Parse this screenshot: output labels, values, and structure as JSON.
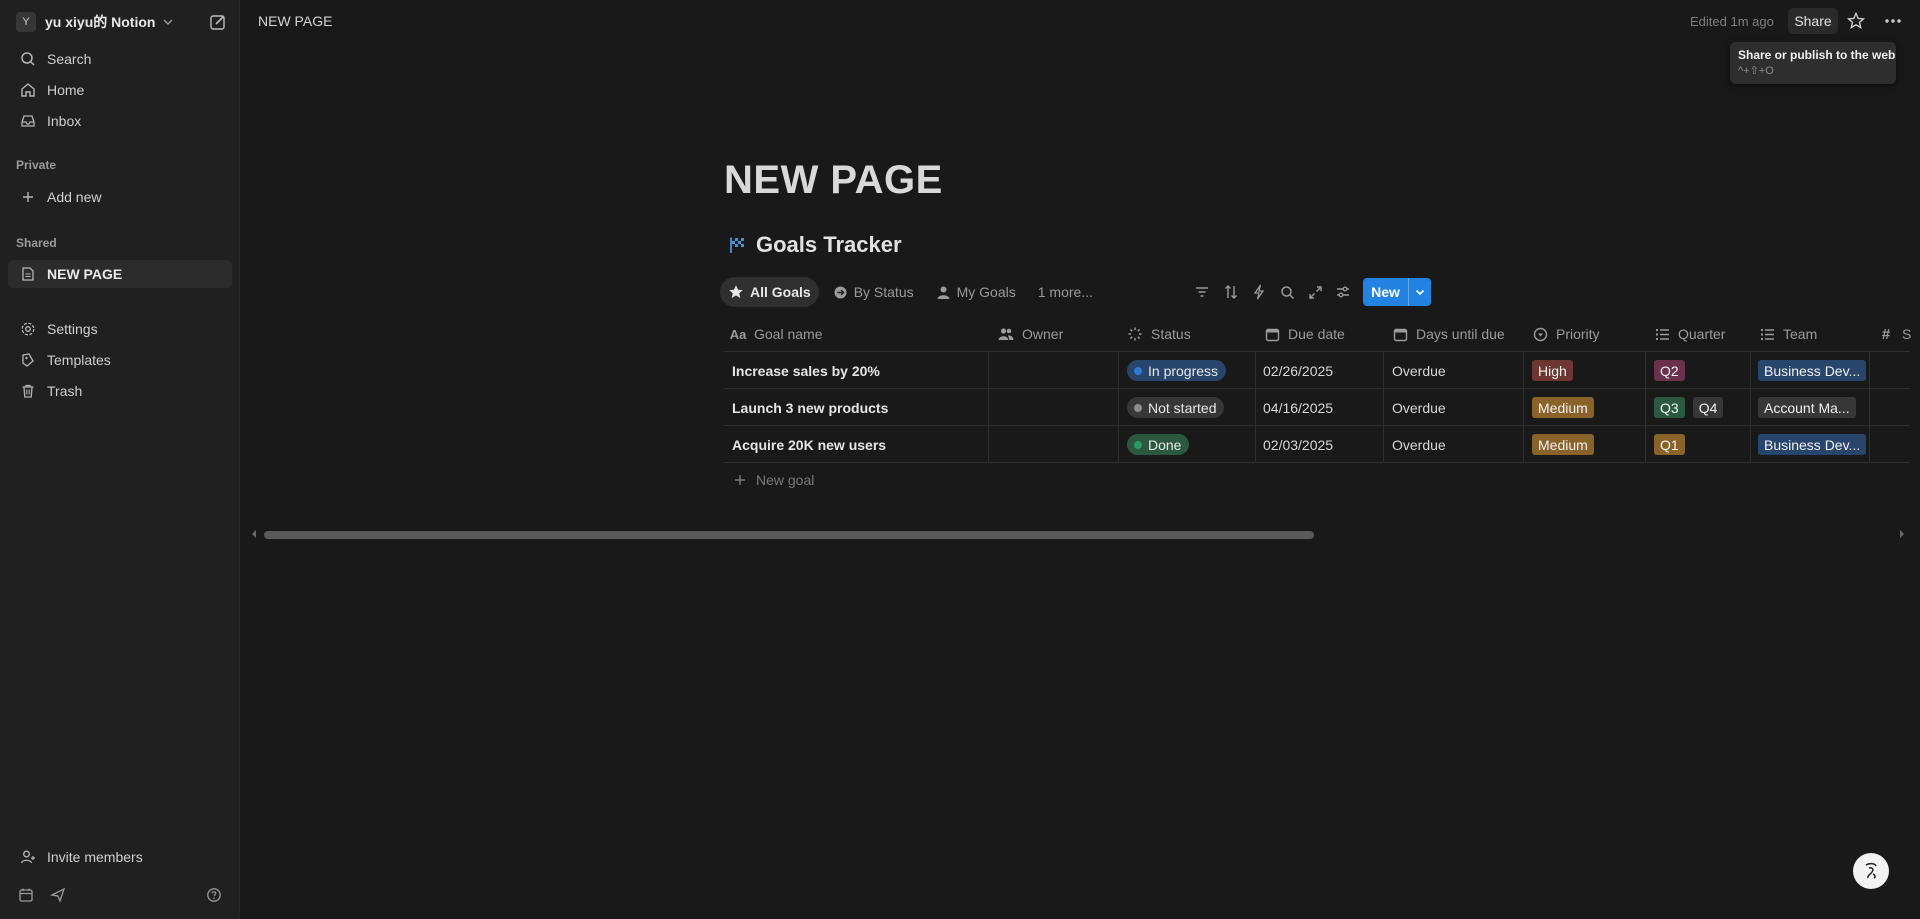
{
  "sidebar": {
    "workspace": {
      "avatar": "Y",
      "name": "yu xiyu的 Notion"
    },
    "nav": [
      {
        "label": "Search",
        "icon": "search-icon"
      },
      {
        "label": "Home",
        "icon": "home-icon"
      },
      {
        "label": "Inbox",
        "icon": "inbox-icon"
      }
    ],
    "private_label": "Private",
    "add_new": "Add new",
    "shared_label": "Shared",
    "shared_page": "NEW PAGE",
    "settings": "Settings",
    "templates": "Templates",
    "trash": "Trash",
    "invite": "Invite members"
  },
  "topbar": {
    "breadcrumb": "NEW PAGE",
    "edited": "Edited 1m ago",
    "share": "Share",
    "tooltip_title": "Share or publish to the web",
    "tooltip_shortcut": "^+⇧+O"
  },
  "page": {
    "title": "NEW PAGE",
    "database_title": "Goals Tracker"
  },
  "views": {
    "tabs": [
      {
        "label": "All Goals",
        "icon": "star-icon",
        "active": true
      },
      {
        "label": "By Status",
        "icon": "status-icon",
        "active": false
      },
      {
        "label": "My Goals",
        "icon": "person-icon",
        "active": false
      }
    ],
    "more": "1 more...",
    "new_button": "New"
  },
  "table": {
    "columns": {
      "goal_name": "Goal name",
      "owner": "Owner",
      "status": "Status",
      "due_date": "Due date",
      "days_until_due": "Days until due",
      "priority": "Priority",
      "quarter": "Quarter",
      "team": "Team",
      "extra": "S"
    },
    "rows": [
      {
        "name": "Increase sales by 20%",
        "owner": "",
        "status": "In progress",
        "due": "02/26/2025",
        "days": "Overdue",
        "priority": "High",
        "quarter": [
          "Q2"
        ],
        "team": "Business Dev..."
      },
      {
        "name": "Launch 3 new products",
        "owner": "",
        "status": "Not started",
        "due": "04/16/2025",
        "days": "Overdue",
        "priority": "Medium",
        "quarter": [
          "Q3",
          "Q4"
        ],
        "team": "Account Ma..."
      },
      {
        "name": "Acquire 20K new users",
        "owner": "",
        "status": "Done",
        "due": "02/03/2025",
        "days": "Overdue",
        "priority": "Medium",
        "quarter": [
          "Q1"
        ],
        "team": "Business Dev..."
      }
    ],
    "new_row": "New goal"
  },
  "colors": {
    "accent": "#2383e2",
    "status_in_progress_bg": "#28456c",
    "status_in_progress_dot": "#2e7cd1",
    "status_not_started_bg": "#373737",
    "status_not_started_dot": "#8c8c8c",
    "status_done_bg": "#2b593f",
    "status_done_dot": "#2d9964",
    "priority_high": "#6e3630",
    "priority_medium": "#89632a",
    "quarter_q2": "#69314c",
    "quarter_q3": "#2b593f",
    "quarter_q4": "#373737",
    "quarter_q1": "#89632a",
    "team_business_dev": "#28456c",
    "team_account_ma": "#373737"
  }
}
